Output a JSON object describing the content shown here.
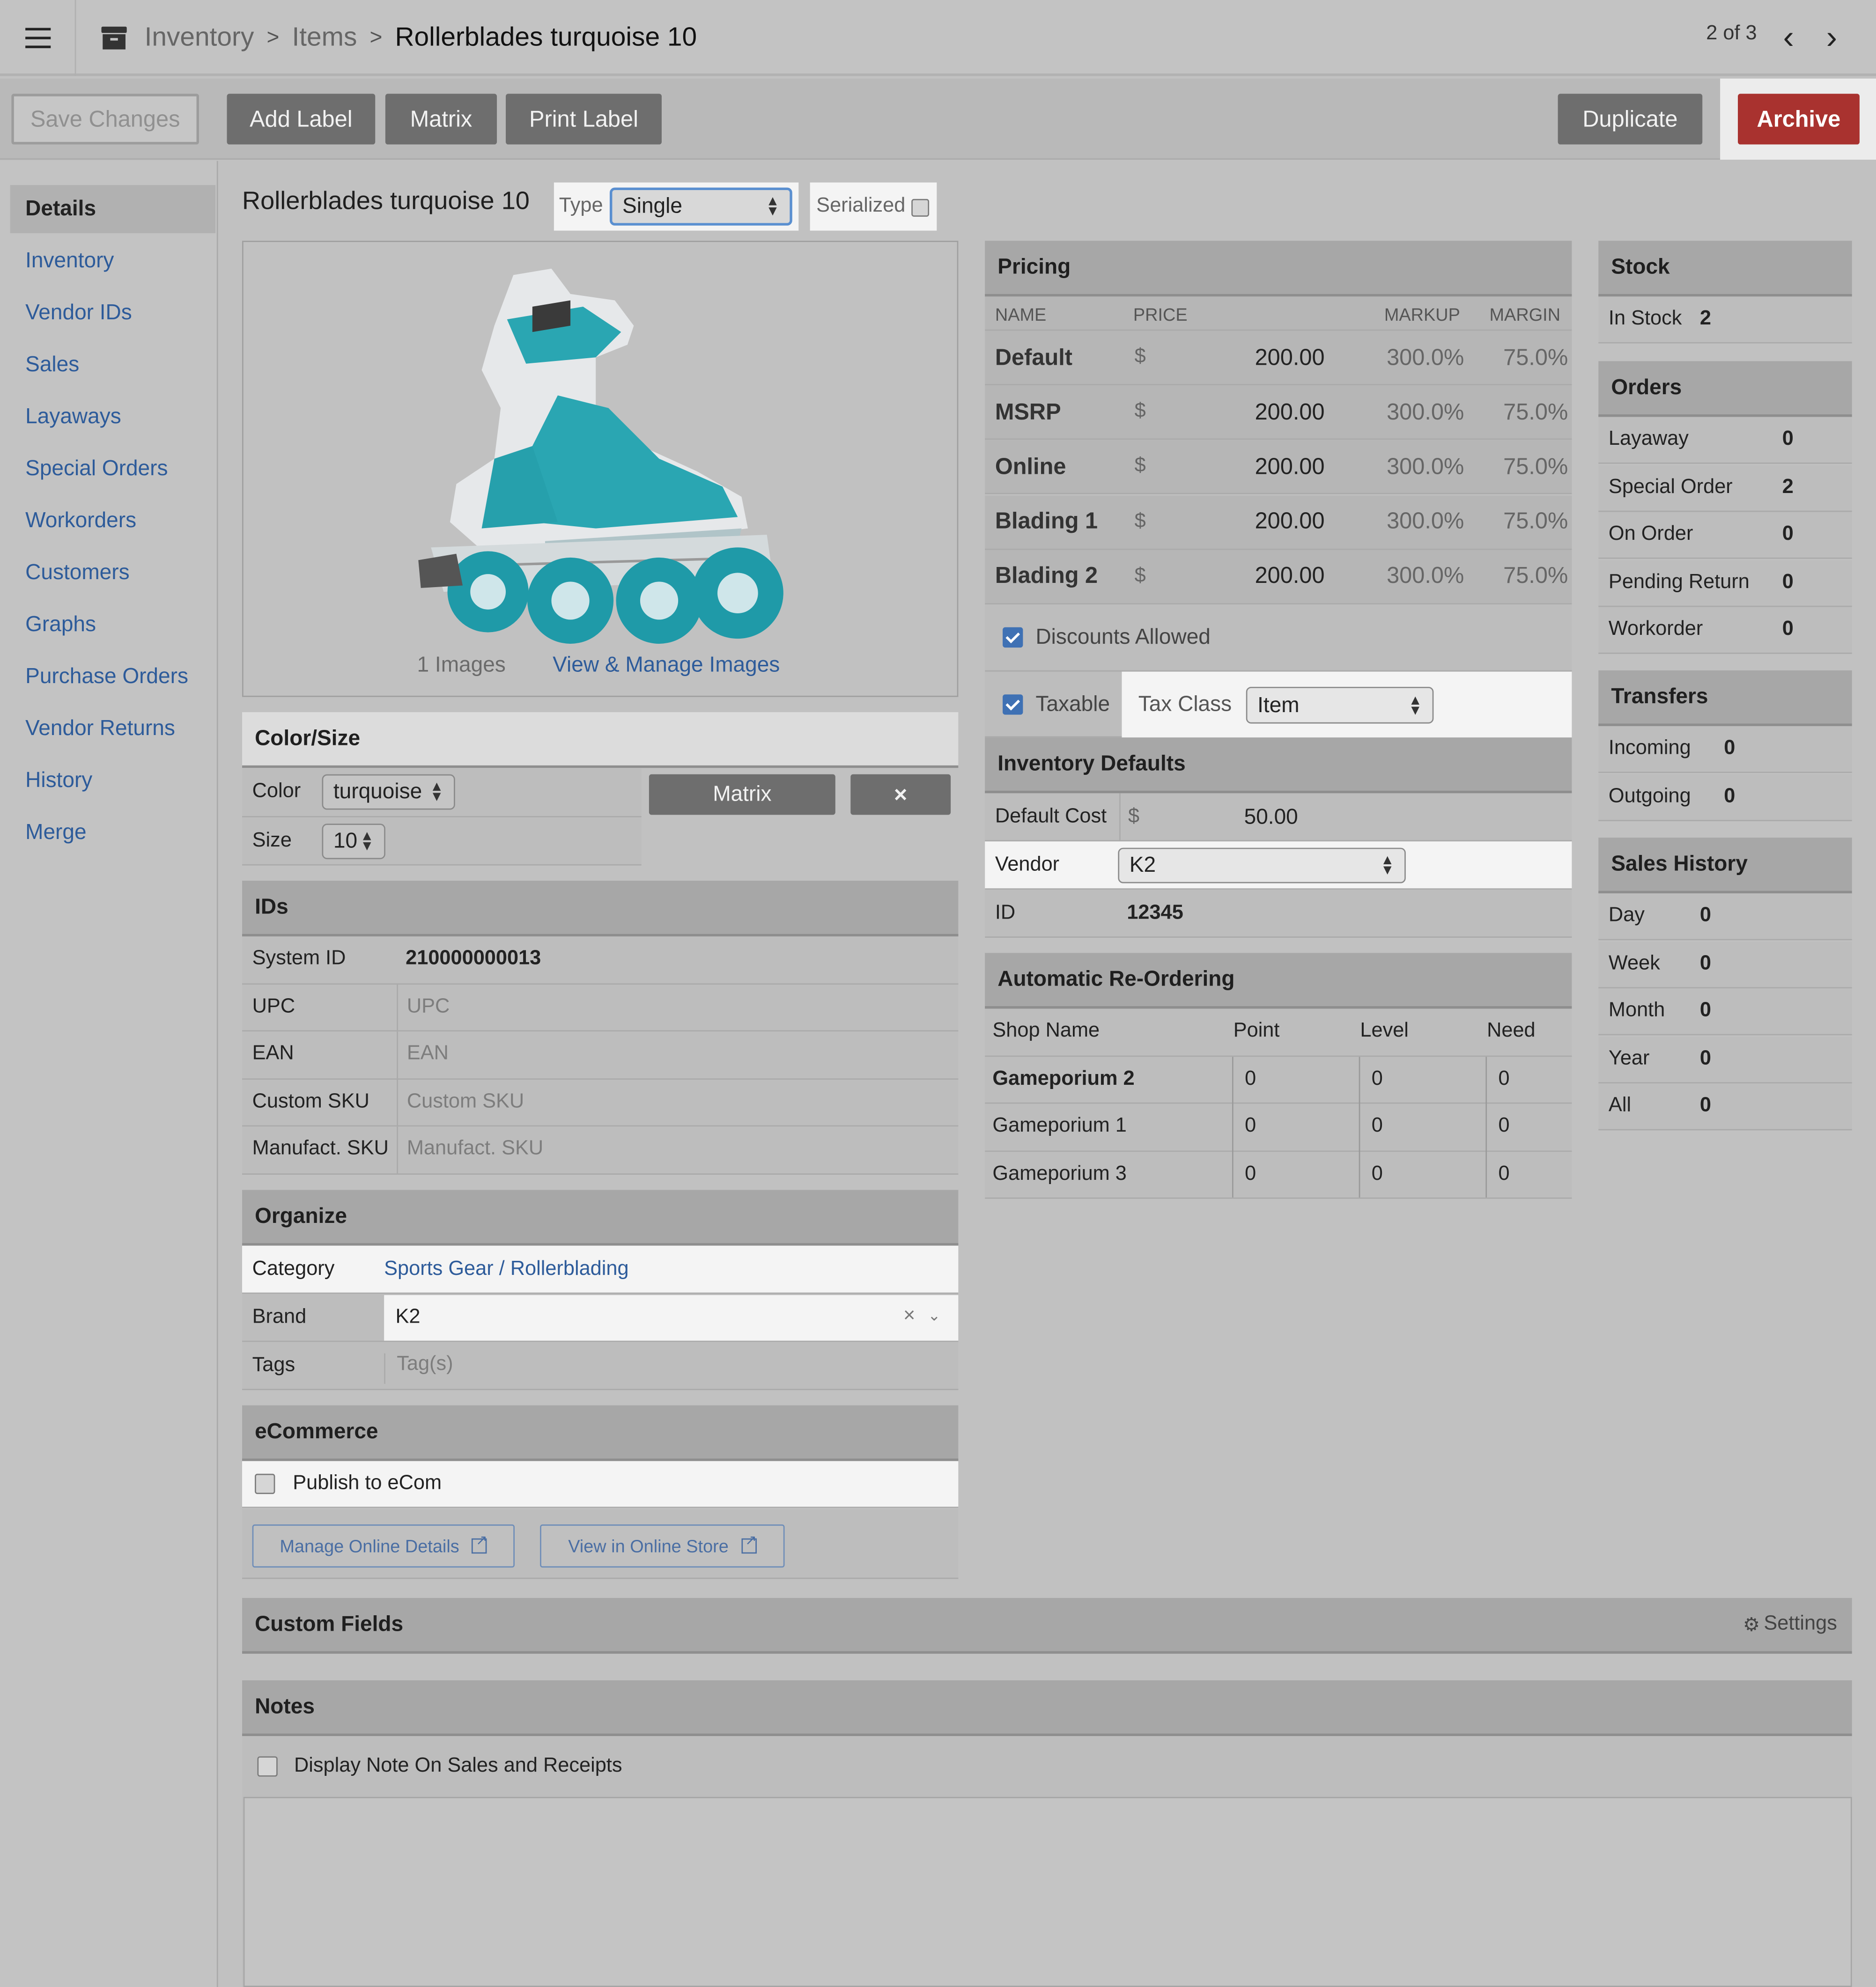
{
  "topbar": {
    "breadcrumb": [
      "Inventory",
      "Items",
      "Rollerblades turquoise 10"
    ],
    "pager": "2 of 3"
  },
  "toolbar": {
    "save": "Save Changes",
    "add_label": "Add Label",
    "matrix": "Matrix",
    "print_label": "Print Label",
    "duplicate": "Duplicate",
    "archive": "Archive"
  },
  "sidebar": {
    "items": [
      "Details",
      "Inventory",
      "Vendor IDs",
      "Sales",
      "Layaways",
      "Special Orders",
      "Workorders",
      "Customers",
      "Graphs",
      "Purchase Orders",
      "Vendor Returns",
      "History",
      "Merge"
    ],
    "active": "Details"
  },
  "item": {
    "title": "Rollerblades turquoise 10",
    "type_label": "Type",
    "type_value": "Single",
    "serialized_label": "Serialized",
    "serialized": false
  },
  "images": {
    "count_text": "1 Images",
    "manage_link": "View & Manage Images"
  },
  "color_size": {
    "title": "Color/Size",
    "color_label": "Color",
    "color_value": "turquoise",
    "size_label": "Size",
    "size_value": "10",
    "matrix_btn": "Matrix",
    "remove_btn": "×"
  },
  "ids": {
    "title": "IDs",
    "rows": [
      {
        "label": "System ID",
        "value": "210000000013",
        "placeholder": false
      },
      {
        "label": "UPC",
        "value": "UPC",
        "placeholder": true
      },
      {
        "label": "EAN",
        "value": "EAN",
        "placeholder": true
      },
      {
        "label": "Custom SKU",
        "value": "Custom SKU",
        "placeholder": true
      },
      {
        "label": "Manufact. SKU",
        "value": "Manufact. SKU",
        "placeholder": true
      }
    ]
  },
  "organize": {
    "title": "Organize",
    "category_label": "Category",
    "category_value": "Sports Gear / Rollerblading",
    "brand_label": "Brand",
    "brand_value": "K2",
    "tags_label": "Tags",
    "tags_placeholder": "Tag(s)"
  },
  "ecommerce": {
    "title": "eCommerce",
    "publish_label": "Publish to eCom",
    "manage_btn": "Manage Online Details",
    "view_btn": "View in Online Store"
  },
  "pricing": {
    "title": "Pricing",
    "headers": [
      "NAME",
      "PRICE",
      "MARKUP",
      "MARGIN"
    ],
    "rows": [
      {
        "name": "Default",
        "currency": "$",
        "price": "200.00",
        "markup": "300.0%",
        "margin": "75.0%"
      },
      {
        "name": "MSRP",
        "currency": "$",
        "price": "200.00",
        "markup": "300.0%",
        "margin": "75.0%"
      },
      {
        "name": "Online",
        "currency": "$",
        "price": "200.00",
        "markup": "300.0%",
        "margin": "75.0%"
      },
      {
        "name": "Blading 1",
        "currency": "$",
        "price": "200.00",
        "markup": "300.0%",
        "margin": "75.0%"
      },
      {
        "name": "Blading 2",
        "currency": "$",
        "price": "200.00",
        "markup": "300.0%",
        "margin": "75.0%"
      }
    ],
    "discounts_label": "Discounts Allowed",
    "taxable_label": "Taxable",
    "tax_class_label": "Tax Class",
    "tax_class_value": "Item"
  },
  "inventory_defaults": {
    "title": "Inventory Defaults",
    "default_cost_label": "Default Cost",
    "currency": "$",
    "default_cost_value": "50.00",
    "vendor_label": "Vendor",
    "vendor_value": "K2",
    "id_label": "ID",
    "id_value": "12345"
  },
  "reorder": {
    "title": "Automatic Re-Ordering",
    "headers": [
      "Shop Name",
      "Point",
      "Level",
      "Need"
    ],
    "rows": [
      {
        "shop": "Gameporium 2",
        "point": "0",
        "level": "0",
        "need": "0"
      },
      {
        "shop": "Gameporium 1",
        "point": "0",
        "level": "0",
        "need": "0"
      },
      {
        "shop": "Gameporium 3",
        "point": "0",
        "level": "0",
        "need": "0"
      }
    ]
  },
  "stock": {
    "title": "Stock",
    "in_stock_label": "In Stock",
    "in_stock_value": "2"
  },
  "orders": {
    "title": "Orders",
    "rows": [
      {
        "label": "Layaway",
        "value": "0"
      },
      {
        "label": "Special Order",
        "value": "2"
      },
      {
        "label": "On Order",
        "value": "0"
      },
      {
        "label": "Pending Return",
        "value": "0"
      },
      {
        "label": "Workorder",
        "value": "0"
      }
    ]
  },
  "transfers": {
    "title": "Transfers",
    "rows": [
      {
        "label": "Incoming",
        "value": "0"
      },
      {
        "label": "Outgoing",
        "value": "0"
      }
    ]
  },
  "sales_history": {
    "title": "Sales History",
    "rows": [
      {
        "label": "Day",
        "value": "0"
      },
      {
        "label": "Week",
        "value": "0"
      },
      {
        "label": "Month",
        "value": "0"
      },
      {
        "label": "Year",
        "value": "0"
      },
      {
        "label": "All",
        "value": "0"
      }
    ]
  },
  "custom_fields": {
    "title": "Custom Fields",
    "settings": "Settings"
  },
  "notes": {
    "title": "Notes",
    "display_label": "Display Note On Sales and Receipts"
  },
  "colors": {
    "accent_link": "#2d5b9a",
    "archive": "#a9322f",
    "checkbox": "#3f71b4",
    "skate_teal": "#2aa6b2"
  }
}
